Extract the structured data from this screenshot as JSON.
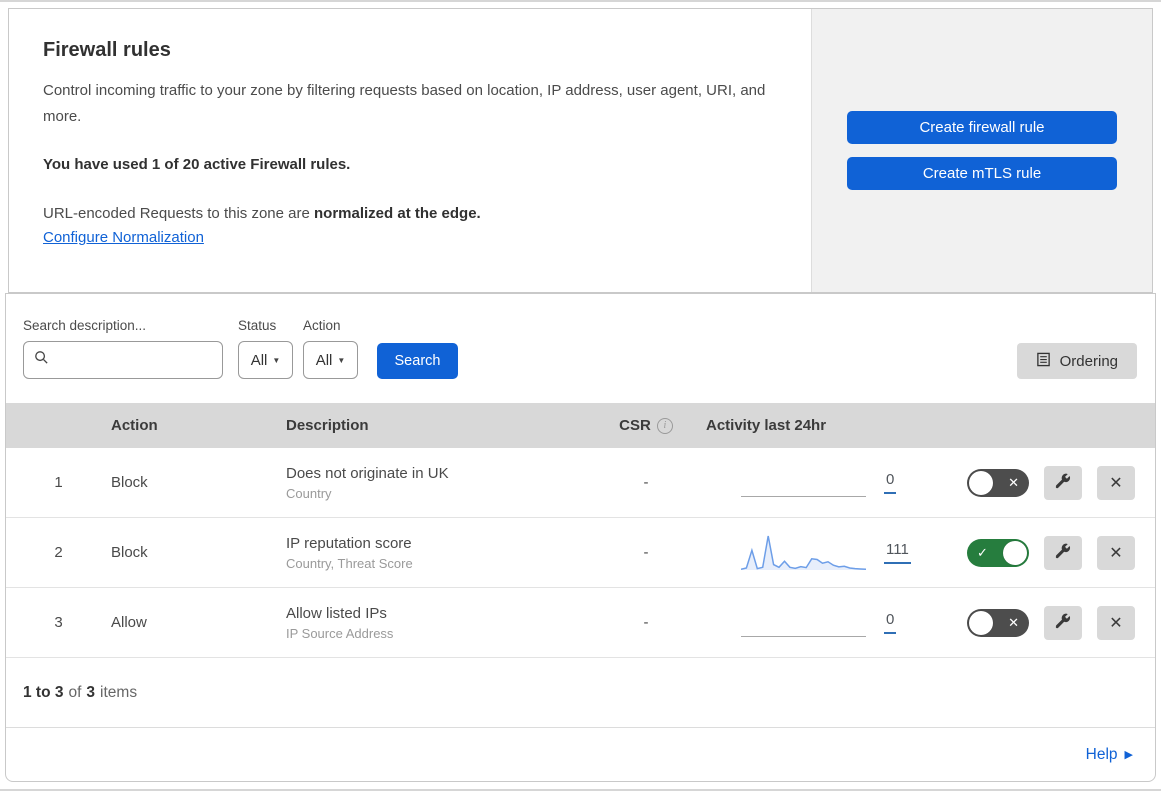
{
  "header": {
    "title": "Firewall rules",
    "description": "Control incoming traffic to your zone by filtering requests based on location, IP address, user agent, URI, and more.",
    "usage": "You have used 1 of 20 active Firewall rules.",
    "normalization_prefix": "URL-encoded Requests to this zone are ",
    "normalization_bold": "normalized at the edge.",
    "normalization_link": "Configure Normalization",
    "buttons": {
      "create_firewall": "Create firewall rule",
      "create_mtls": "Create mTLS rule"
    }
  },
  "filters": {
    "search_label": "Search description...",
    "search_value": "",
    "status_label": "Status",
    "status_value": "All",
    "action_label": "Action",
    "action_value": "All",
    "search_button": "Search",
    "ordering_button": "Ordering"
  },
  "table": {
    "columns": {
      "action": "Action",
      "description": "Description",
      "csr": "CSR",
      "activity": "Activity last 24hr"
    },
    "rows": [
      {
        "priority": "1",
        "action": "Block",
        "description": "Does not originate in UK",
        "fields": "Country",
        "csr": "-",
        "activity_count": "0",
        "enabled": false,
        "sparkline": []
      },
      {
        "priority": "2",
        "action": "Block",
        "description": "IP reputation score",
        "fields": "Country, Threat Score",
        "csr": "-",
        "activity_count": "111",
        "enabled": true,
        "sparkline": [
          2,
          6,
          58,
          4,
          8,
          100,
          16,
          8,
          26,
          8,
          5,
          10,
          7,
          33,
          31,
          20,
          24,
          14,
          9,
          11,
          6,
          4,
          3,
          2
        ]
      },
      {
        "priority": "3",
        "action": "Allow",
        "description": "Allow listed IPs",
        "fields": "IP Source Address",
        "csr": "-",
        "activity_count": "0",
        "enabled": false,
        "sparkline": []
      }
    ]
  },
  "footer": {
    "range": "1 to 3",
    "of_text": "of",
    "total": "3",
    "items_text": "items",
    "help_label": "Help"
  },
  "icons": {
    "search": "magnifier",
    "caret_down": "▼",
    "info": "i",
    "ordering": "document-lines",
    "wrench": "wrench",
    "close": "✕",
    "toggle_on_mark": "✓",
    "toggle_off_mark": "✕",
    "help_arrow": "▶"
  },
  "colors": {
    "primary_blue": "#1062d6",
    "toggle_on_green": "#267d3e",
    "toggle_off_gray": "#4d4d4d",
    "sparkline_stroke": "#6d9ee8",
    "sparkline_fill": "#e7eefb",
    "table_header_bg": "#d8d8d8"
  }
}
